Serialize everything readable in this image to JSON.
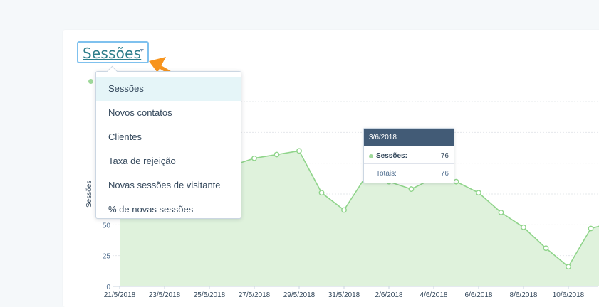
{
  "metric_selector": {
    "label": "Sessões",
    "options": [
      "Sessões",
      "Novos contatos",
      "Clientes",
      "Taxa de rejeição",
      "Novas sessões de visitante",
      "% de novas sessões"
    ],
    "selected_index": 0
  },
  "colors": {
    "series_line": "#8fd48a",
    "series_fill": "#dff2dc",
    "accent_link": "#2d7d8a",
    "tooltip_header": "#425b76"
  },
  "tooltip": {
    "date": "3/6/2018",
    "series_label": "Sessões:",
    "series_value": "76",
    "total_label": "Totais:",
    "total_value": "76"
  },
  "chart_data": {
    "type": "area",
    "ylabel": "Sessões",
    "y_ticks": [
      "0",
      "25",
      "50"
    ],
    "ylim": [
      0,
      150
    ],
    "grid": true,
    "x_tick_labels": [
      "21/5/2018",
      "23/5/2018",
      "25/5/2018",
      "27/5/2018",
      "29/5/2018",
      "31/5/2018",
      "2/6/2018",
      "4/6/2018",
      "6/6/2018",
      "8/6/2018",
      "10/6/2018",
      "12"
    ],
    "x": [
      "21/5/2018",
      "22/5/2018",
      "23/5/2018",
      "24/5/2018",
      "25/5/2018",
      "26/5/2018",
      "27/5/2018",
      "28/5/2018",
      "29/5/2018",
      "30/5/2018",
      "31/5/2018",
      "1/6/2018",
      "2/6/2018",
      "3/6/2018",
      "4/6/2018",
      "5/6/2018",
      "6/6/2018",
      "7/6/2018",
      "8/6/2018",
      "9/6/2018",
      "10/6/2018",
      "11/6/2018",
      "12/6/2018"
    ],
    "series": [
      {
        "values": [
          88,
          92,
          95,
          98,
          100,
          98,
          104,
          107,
          110,
          76,
          62,
          90,
          85,
          79,
          88,
          85,
          76,
          60,
          48,
          31,
          16,
          47,
          52
        ]
      }
    ]
  }
}
